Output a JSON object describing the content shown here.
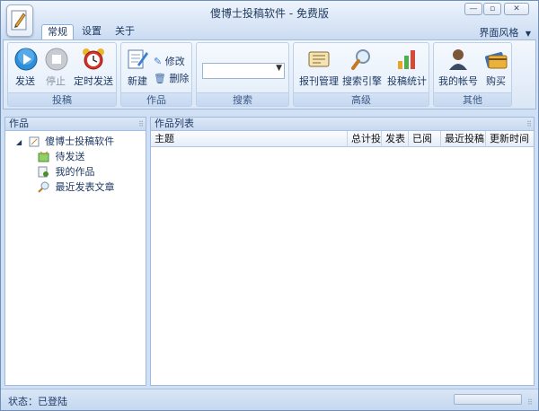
{
  "window": {
    "title": "傻博士投稿软件 - 免费版"
  },
  "menu": {
    "tabs": [
      {
        "label": "常规"
      },
      {
        "label": "设置"
      },
      {
        "label": "关于"
      }
    ],
    "theme_label": "界面风格"
  },
  "ribbon": {
    "groups": {
      "submit": {
        "label": "投稿",
        "send": "发送",
        "stop": "停止",
        "timed_send": "定时发送"
      },
      "works": {
        "label": "作品",
        "new": "新建",
        "edit": "修改",
        "delete": "删除"
      },
      "search": {
        "label": "搜索",
        "value": ""
      },
      "advanced": {
        "label": "高级",
        "journal_mgmt": "报刊管理",
        "search_engine": "搜索引擎",
        "stats": "投稿统计"
      },
      "other": {
        "label": "其他",
        "account": "我的帐号",
        "buy": "购买"
      }
    }
  },
  "left_pane": {
    "title": "作品",
    "tree": {
      "root": "傻博士投稿软件",
      "children": [
        "待发送",
        "我的作品",
        "最近发表文章"
      ]
    }
  },
  "right_pane": {
    "title": "作品列表",
    "columns": [
      "主题",
      "总计投",
      "发表",
      "已阅",
      "最近投稿",
      "更新时间"
    ]
  },
  "status": {
    "text": "状态：已登陆"
  },
  "colors": {
    "accent": "#cfe0f5",
    "border": "#9fbadc"
  }
}
